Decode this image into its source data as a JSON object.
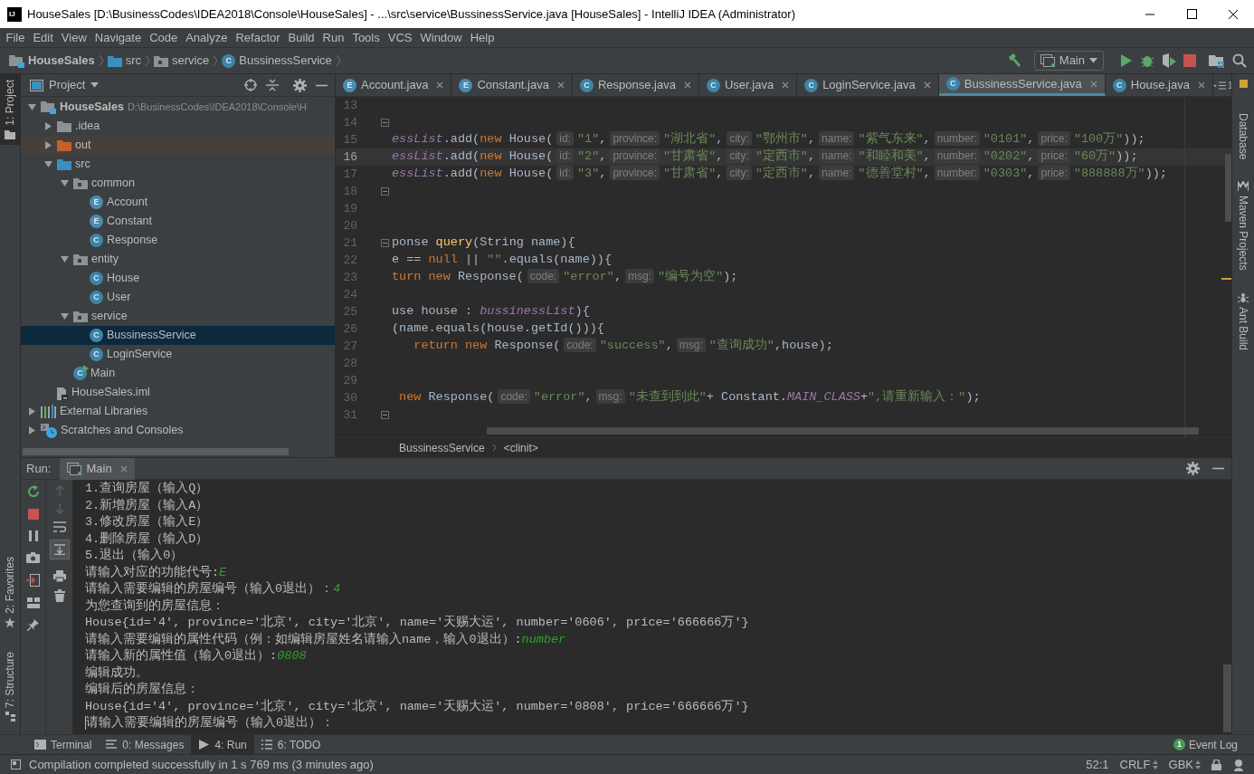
{
  "window": {
    "logo": "IJ",
    "title": "HouseSales [D:\\BusinessCodes\\IDEA2018\\Console\\HouseSales] - ...\\src\\service\\BussinessService.java [HouseSales] - IntelliJ IDEA (Administrator)"
  },
  "menu": [
    "File",
    "Edit",
    "View",
    "Navigate",
    "Code",
    "Analyze",
    "Refactor",
    "Build",
    "Run",
    "Tools",
    "VCS",
    "Window",
    "Help"
  ],
  "breadcrumbs": [
    {
      "label": "HouseSales",
      "kind": "module"
    },
    {
      "label": "src",
      "kind": "source-folder"
    },
    {
      "label": "service",
      "kind": "package"
    },
    {
      "label": "BussinessService",
      "kind": "class",
      "badge": "C"
    }
  ],
  "run_configuration": "Main",
  "left_tool_windows": {
    "top": [
      {
        "label": "1: Project",
        "kind": "project",
        "selected": true
      }
    ],
    "bottom": [
      {
        "label": "2: Favorites",
        "kind": "favorites",
        "selected": false
      },
      {
        "label": "7: Structure",
        "kind": "structure",
        "selected": false
      }
    ]
  },
  "right_tool_windows": [
    {
      "label": "Database",
      "kind": "database"
    },
    {
      "label": "Maven Projects",
      "kind": "maven"
    },
    {
      "label": "Ant Build",
      "kind": "ant"
    }
  ],
  "project_panel": {
    "title": "Project",
    "tree": [
      {
        "label": "HouseSales",
        "path": "D:\\BusinessCodes\\IDEA2018\\Console\\H",
        "kind": "module",
        "expanded": true,
        "selected": false,
        "children": [
          {
            "label": ".idea",
            "kind": "folder",
            "expanded": false,
            "selected": false
          },
          {
            "label": "out",
            "kind": "excluded-folder",
            "expanded": false,
            "selected": false
          },
          {
            "label": "src",
            "kind": "source-folder",
            "expanded": true,
            "selected": false,
            "children": [
              {
                "label": "common",
                "kind": "package",
                "expanded": true,
                "selected": false,
                "children": [
                  {
                    "label": "Account",
                    "kind": "enum",
                    "badge": "E",
                    "selected": false
                  },
                  {
                    "label": "Constant",
                    "kind": "enum",
                    "badge": "E",
                    "selected": false
                  },
                  {
                    "label": "Response",
                    "kind": "class",
                    "badge": "C",
                    "selected": false
                  }
                ]
              },
              {
                "label": "entity",
                "kind": "package",
                "expanded": true,
                "selected": false,
                "children": [
                  {
                    "label": "House",
                    "kind": "class",
                    "badge": "C",
                    "selected": false
                  },
                  {
                    "label": "User",
                    "kind": "class",
                    "badge": "C",
                    "selected": false
                  }
                ]
              },
              {
                "label": "service",
                "kind": "package",
                "expanded": true,
                "selected": false,
                "children": [
                  {
                    "label": "BussinessService",
                    "kind": "class",
                    "badge": "C",
                    "selected": true
                  },
                  {
                    "label": "LoginService",
                    "kind": "class",
                    "badge": "C",
                    "selected": false
                  }
                ]
              },
              {
                "label": "Main",
                "kind": "main-class",
                "badge": "C",
                "selected": false
              }
            ]
          },
          {
            "label": "HouseSales.iml",
            "kind": "iml",
            "selected": false
          }
        ]
      },
      {
        "label": "External Libraries",
        "kind": "libraries",
        "expanded": false,
        "selected": false
      },
      {
        "label": "Scratches and Consoles",
        "kind": "scratches",
        "expanded": false,
        "selected": false
      }
    ]
  },
  "editor": {
    "tabs": [
      {
        "label": "Account.java",
        "kind": "enum",
        "badge": "E",
        "selected": false
      },
      {
        "label": "Constant.java",
        "kind": "enum",
        "badge": "E",
        "selected": false
      },
      {
        "label": "Response.java",
        "kind": "class",
        "badge": "C",
        "selected": false
      },
      {
        "label": "User.java",
        "kind": "class",
        "badge": "C",
        "selected": false
      },
      {
        "label": "LoginService.java",
        "kind": "class",
        "badge": "C",
        "selected": false
      },
      {
        "label": "BussinessService.java",
        "kind": "class",
        "badge": "C",
        "selected": true
      },
      {
        "label": "House.java",
        "kind": "class",
        "badge": "C",
        "selected": false
      }
    ],
    "tab_overflow_count": "1",
    "lines": [
      {
        "number": "13",
        "fold": false,
        "current": false
      },
      {
        "number": "14",
        "fold": true,
        "current": false
      },
      {
        "number": "15",
        "fold": false,
        "current": false,
        "tokens": [
          {
            "kind": "field",
            "text": "essList"
          },
          {
            "kind": "plain",
            "text": ".add("
          },
          {
            "kind": "keyword",
            "text": "new"
          },
          {
            "kind": "plain",
            "text": " House("
          },
          {
            "kind": "hint",
            "text": "id:"
          },
          {
            "kind": "string",
            "text": "\"1\""
          },
          {
            "kind": "plain",
            "text": ","
          },
          {
            "kind": "hint",
            "text": "province:"
          },
          {
            "kind": "string",
            "text": "\"湖北省\""
          },
          {
            "kind": "plain",
            "text": ","
          },
          {
            "kind": "hint",
            "text": "city:"
          },
          {
            "kind": "string",
            "text": "\"鄂州市\""
          },
          {
            "kind": "plain",
            "text": ","
          },
          {
            "kind": "hint",
            "text": "name:"
          },
          {
            "kind": "string",
            "text": "\"紫气东来\""
          },
          {
            "kind": "plain",
            "text": ","
          },
          {
            "kind": "hint",
            "text": "number:"
          },
          {
            "kind": "string",
            "text": "\"0101\""
          },
          {
            "kind": "plain",
            "text": ","
          },
          {
            "kind": "hint",
            "text": "price:"
          },
          {
            "kind": "string",
            "text": "\"100万\""
          },
          {
            "kind": "plain",
            "text": "));"
          }
        ]
      },
      {
        "number": "16",
        "fold": false,
        "current": true,
        "tokens": [
          {
            "kind": "field",
            "text": "essList"
          },
          {
            "kind": "plain",
            "text": ".add("
          },
          {
            "kind": "keyword",
            "text": "new"
          },
          {
            "kind": "plain",
            "text": " House("
          },
          {
            "kind": "hint",
            "text": "id:"
          },
          {
            "kind": "string",
            "text": "\"2\""
          },
          {
            "kind": "plain",
            "text": ","
          },
          {
            "kind": "hint",
            "text": "province:"
          },
          {
            "kind": "string",
            "text": "\"甘肃省\""
          },
          {
            "kind": "plain",
            "text": ","
          },
          {
            "kind": "hint",
            "text": "city:"
          },
          {
            "kind": "string",
            "text": "\"定西市\""
          },
          {
            "kind": "plain",
            "text": ","
          },
          {
            "kind": "hint",
            "text": "name:"
          },
          {
            "kind": "string",
            "text": "\"和睦和美\""
          },
          {
            "kind": "plain",
            "text": ","
          },
          {
            "kind": "hint",
            "text": "number:"
          },
          {
            "kind": "string",
            "text": "\"0202\""
          },
          {
            "kind": "plain",
            "text": ","
          },
          {
            "kind": "hint",
            "text": "price:"
          },
          {
            "kind": "string",
            "text": "\"60万\""
          },
          {
            "kind": "plain",
            "text": "));"
          }
        ]
      },
      {
        "number": "17",
        "fold": false,
        "current": false,
        "tokens": [
          {
            "kind": "field",
            "text": "essList"
          },
          {
            "kind": "plain",
            "text": ".add("
          },
          {
            "kind": "keyword",
            "text": "new"
          },
          {
            "kind": "plain",
            "text": " House("
          },
          {
            "kind": "hint",
            "text": "id:"
          },
          {
            "kind": "string",
            "text": "\"3\""
          },
          {
            "kind": "plain",
            "text": ","
          },
          {
            "kind": "hint",
            "text": "province:"
          },
          {
            "kind": "string",
            "text": "\"甘肃省\""
          },
          {
            "kind": "plain",
            "text": ","
          },
          {
            "kind": "hint",
            "text": "city:"
          },
          {
            "kind": "string",
            "text": "\"定西市\""
          },
          {
            "kind": "plain",
            "text": ","
          },
          {
            "kind": "hint",
            "text": "name:"
          },
          {
            "kind": "string",
            "text": "\"德善堂村\""
          },
          {
            "kind": "plain",
            "text": ","
          },
          {
            "kind": "hint",
            "text": "number:"
          },
          {
            "kind": "string",
            "text": "\"0303\""
          },
          {
            "kind": "plain",
            "text": ","
          },
          {
            "kind": "hint",
            "text": "price:"
          },
          {
            "kind": "string",
            "text": "\"888888万\""
          },
          {
            "kind": "plain",
            "text": "));"
          }
        ]
      },
      {
        "number": "18",
        "fold": true,
        "current": false
      },
      {
        "number": "19",
        "fold": false,
        "current": false
      },
      {
        "number": "20",
        "fold": false,
        "current": false
      },
      {
        "number": "21",
        "fold": true,
        "current": false,
        "tokens": [
          {
            "kind": "plain",
            "text": "ponse "
          },
          {
            "kind": "method",
            "text": "query"
          },
          {
            "kind": "plain",
            "text": "(String name){"
          }
        ]
      },
      {
        "number": "22",
        "fold": false,
        "current": false,
        "tokens": [
          {
            "kind": "plain",
            "text": "e == "
          },
          {
            "kind": "keyword",
            "text": "null"
          },
          {
            "kind": "plain",
            "text": " || "
          },
          {
            "kind": "string",
            "text": "\"\""
          },
          {
            "kind": "plain",
            "text": ".equals(name)){"
          }
        ]
      },
      {
        "number": "23",
        "fold": false,
        "current": false,
        "tokens": [
          {
            "kind": "keyword",
            "text": "turn new"
          },
          {
            "kind": "plain",
            "text": " Response("
          },
          {
            "kind": "hint",
            "text": "code:"
          },
          {
            "kind": "string",
            "text": "\"error\""
          },
          {
            "kind": "plain",
            "text": ","
          },
          {
            "kind": "hint",
            "text": "msg:"
          },
          {
            "kind": "string",
            "text": "\"编号为空\""
          },
          {
            "kind": "plain",
            "text": ");"
          }
        ]
      },
      {
        "number": "24",
        "fold": false,
        "current": false
      },
      {
        "number": "25",
        "fold": false,
        "current": false,
        "tokens": [
          {
            "kind": "plain",
            "text": "use house : "
          },
          {
            "kind": "field",
            "text": "bussinessList"
          },
          {
            "kind": "plain",
            "text": "){"
          }
        ]
      },
      {
        "number": "26",
        "fold": false,
        "current": false,
        "tokens": [
          {
            "kind": "plain",
            "text": "(name.equals(house.getId())){"
          }
        ]
      },
      {
        "number": "27",
        "fold": false,
        "current": false,
        "tokens": [
          {
            "kind": "keyword",
            "text": "   return new"
          },
          {
            "kind": "plain",
            "text": " Response("
          },
          {
            "kind": "hint",
            "text": "code:"
          },
          {
            "kind": "string",
            "text": "\"success\""
          },
          {
            "kind": "plain",
            "text": ","
          },
          {
            "kind": "hint",
            "text": "msg:"
          },
          {
            "kind": "string",
            "text": "\"查询成功\""
          },
          {
            "kind": "plain",
            "text": ",house);"
          }
        ]
      },
      {
        "number": "28",
        "fold": false,
        "current": false
      },
      {
        "number": "29",
        "fold": false,
        "current": false
      },
      {
        "number": "30",
        "fold": false,
        "current": false,
        "tokens": [
          {
            "kind": "keyword",
            "text": " new"
          },
          {
            "kind": "plain",
            "text": " Response("
          },
          {
            "kind": "hint",
            "text": "code:"
          },
          {
            "kind": "string",
            "text": "\"error\""
          },
          {
            "kind": "plain",
            "text": ","
          },
          {
            "kind": "hint",
            "text": "msg:"
          },
          {
            "kind": "string",
            "text": "\"未查到到此\""
          },
          {
            "kind": "plain",
            "text": "+ Constant."
          },
          {
            "kind": "field",
            "text": "MAIN_CLASS"
          },
          {
            "kind": "plain",
            "text": "+"
          },
          {
            "kind": "string",
            "text": "\",请重新输入：\""
          },
          {
            "kind": "plain",
            "text": ");"
          }
        ]
      },
      {
        "number": "31",
        "fold": true,
        "current": false
      }
    ],
    "breadcrumbs": [
      "BussinessService",
      "<clinit>"
    ]
  },
  "run_panel": {
    "label": "Run:",
    "tabs": [
      {
        "label": "Main",
        "selected": true
      }
    ],
    "console": [
      {
        "text": "1.查询房屋（输入Q）"
      },
      {
        "text": "2.新增房屋（输入A）"
      },
      {
        "text": "3.修改房屋（输入E）"
      },
      {
        "text": "4.删除房屋（输入D）"
      },
      {
        "text": "5.退出（输入0）"
      },
      {
        "text": "请输入对应的功能代号:",
        "input": "E"
      },
      {
        "text": "请输入需要编辑的房屋编号（输入0退出）：",
        "input": "4"
      },
      {
        "text": "为您查询到的房屋信息："
      },
      {
        "text": "House{id='4', province='北京', city='北京', name='天赐大运', number='0606', price='666666万'}"
      },
      {
        "text": "请输入需要编辑的属性代码（例：如编辑房屋姓名请输入name，输入0退出）:",
        "input": "number"
      },
      {
        "text": "请输入新的属性值（输入0退出）:",
        "input": "0808"
      },
      {
        "text": "编辑成功。"
      },
      {
        "text": "编辑后的房屋信息："
      },
      {
        "text": "House{id='4', province='北京', city='北京', name='天赐大运', number='0808', price='666666万'}"
      },
      {
        "text": "请输入需要编辑的房屋编号（输入0退出）：",
        "cursor": true
      }
    ]
  },
  "bottom_tabs": [
    {
      "label": "Terminal",
      "kind": "terminal",
      "selected": false
    },
    {
      "label": "0: Messages",
      "kind": "messages",
      "selected": false
    },
    {
      "label": "4: Run",
      "kind": "run",
      "selected": true
    },
    {
      "label": "6: TODO",
      "kind": "todo",
      "selected": false
    }
  ],
  "event_log": {
    "label": "Event Log",
    "count": "1"
  },
  "status_bar": {
    "message": "Compilation completed successfully in 1 s 769 ms (3 minutes ago)",
    "position": "52:1",
    "line_separator": "CRLF",
    "encoding": "GBK"
  }
}
